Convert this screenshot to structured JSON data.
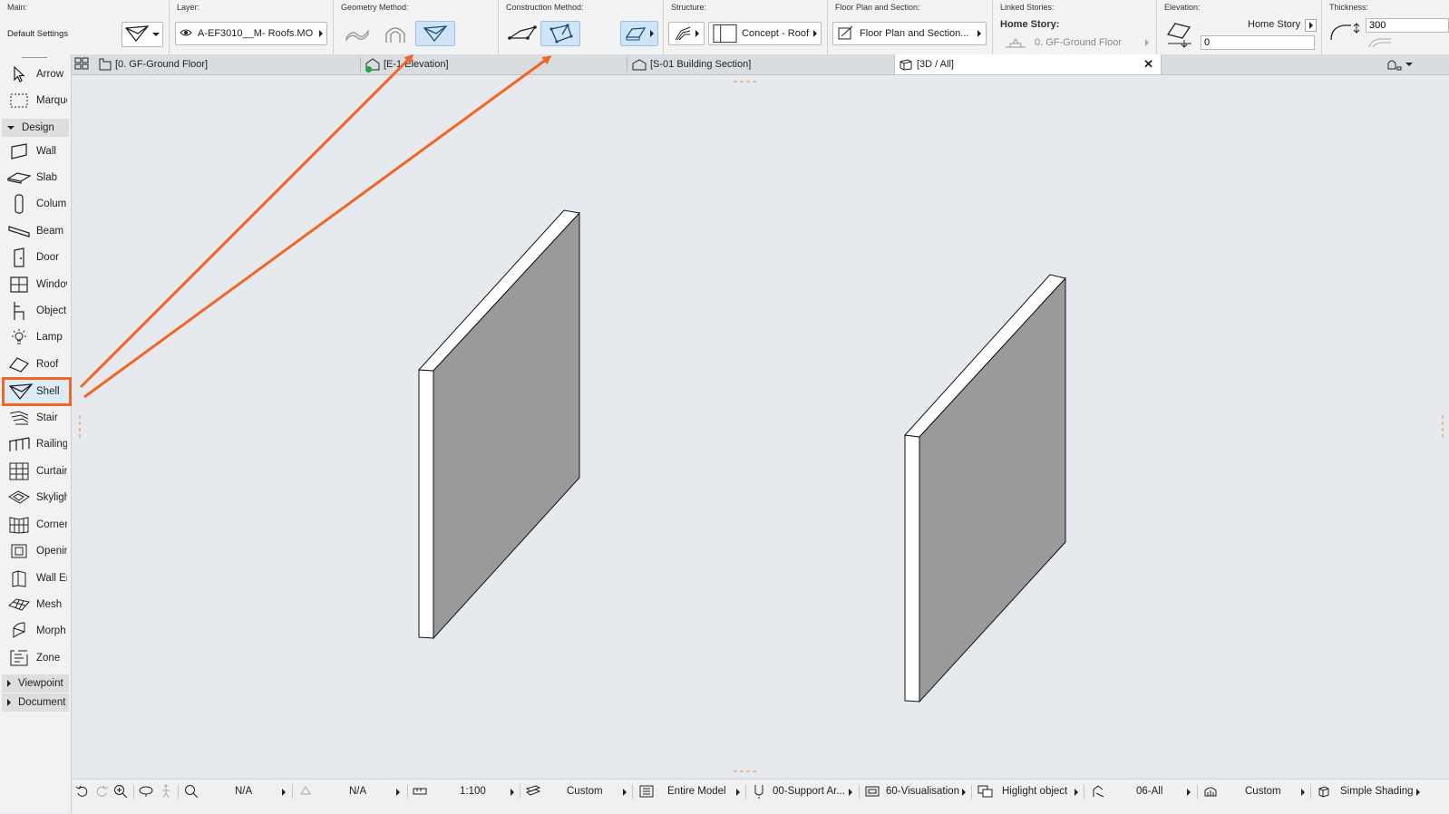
{
  "infobox": {
    "main": {
      "title": "Main:",
      "settings": "Default Settings"
    },
    "layer": {
      "title": "Layer:",
      "value": "A-EF3010__M- Roofs.MO..."
    },
    "geometry": {
      "title": "Geometry Method:"
    },
    "construction": {
      "title": "Construction Method:"
    },
    "structure": {
      "title": "Structure:",
      "value": "Concept - Roof"
    },
    "floorplan": {
      "title": "Floor Plan and Section:",
      "value": "Floor Plan and Section..."
    },
    "linked": {
      "title": "Linked Stories:",
      "home_label": "Home Story:",
      "home_value": "0. GF-Ground Floor"
    },
    "elevation": {
      "title": "Elevation:",
      "ref": "Home Story",
      "value": "0"
    },
    "thickness": {
      "title": "Thickness:",
      "value": "300"
    }
  },
  "toolbox": {
    "top_tools": [
      "Arrow",
      "Marquee"
    ],
    "design_label": "Design",
    "design_tools": [
      "Wall",
      "Slab",
      "Column",
      "Beam",
      "Door",
      "Window",
      "Object",
      "Lamp",
      "Roof",
      "Shell",
      "Stair",
      "Railing",
      "Curtain Wall",
      "Skylight",
      "Corner Window",
      "Opening",
      "Wall End",
      "Mesh",
      "Morph",
      "Zone"
    ],
    "selected_tool": "Shell",
    "viewpoint_label": "Viewpoint",
    "document_label": "Document"
  },
  "tabs": [
    {
      "label": "[0. GF-Ground Floor]",
      "icon": "floor-plan-icon"
    },
    {
      "label": "[E-1 Elevation]",
      "icon": "elevation-icon"
    },
    {
      "label": "[S-01 Building Section]",
      "icon": "section-icon"
    },
    {
      "label": "[3D / All]",
      "icon": "cube-icon",
      "active": true
    }
  ],
  "statusbar": {
    "na1": "N/A",
    "na2": "N/A",
    "scale": "1:100",
    "pen": "Custom",
    "model": "Entire Model",
    "layer_combo": "00-Support Ar...",
    "mvo": "60-Visualisation",
    "highlight": "Higlight object",
    "renovation": "06-All",
    "custom2": "Custom",
    "shading": "Simple Shading"
  },
  "colors": {
    "accent": "#f26522",
    "select": "#cfe4f7",
    "wall_face": "#9a9a9a",
    "background": "#e6eaee"
  }
}
